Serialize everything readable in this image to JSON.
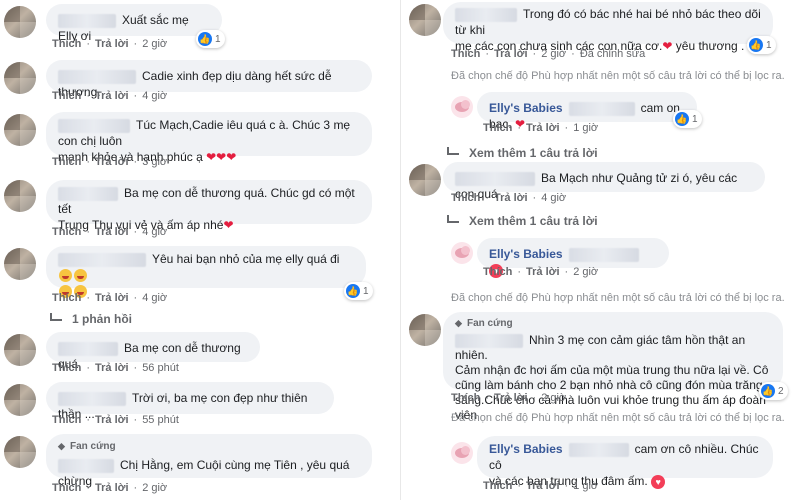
{
  "actions": {
    "like": "Thích",
    "reply": "Trả lời",
    "edited": "Đã chỉnh sửa"
  },
  "badge": {
    "fan": "Fan cứng"
  },
  "left": {
    "c1": {
      "text": "Xuất sắc mẹ Elly ơi",
      "time": "2 giờ",
      "react_count": "1"
    },
    "c2": {
      "text": "Cadie xinh đẹp dịu dàng hết sức dễ thương.",
      "time": "4 giờ"
    },
    "c3": {
      "text_1": "Túc Mạch,Cadie iêu quá c à. Chúc 3 mẹ con chị luôn",
      "text_2": "mạnh khỏe và hạnh phúc ạ",
      "time": "3 giờ"
    },
    "c4": {
      "text_1": "Ba mẹ con dễ thương quá. Chúc gd có một tết",
      "text_2": "Trung Thu vui vẻ và ấm áp nhé",
      "time": "4 giờ"
    },
    "c5": {
      "text_1": "Yêu hai bạn nhỏ của mẹ elly quá đi",
      "time": "4 giờ",
      "react_count": "1",
      "replies": "1 phản hồi"
    },
    "c6": {
      "text": "Ba mẹ con dễ thương quá",
      "time": "56 phút"
    },
    "c7": {
      "text": "Trời ơi, ba mẹ con đẹp như thiên thần ...",
      "time": "55 phút"
    },
    "c8": {
      "text": "Chị Hằng, em Cuội cùng mẹ Tiên , yêu quá chừng",
      "time": "2 giờ"
    }
  },
  "right": {
    "c1": {
      "text_1": "Trong đó có bác nhé hai bé nhỏ bác theo dõi từ khi",
      "text_2": "mẹ các con chưa sinh các con nữa cơ.",
      "text_3": "yêu thương .",
      "time": "2 giờ",
      "react_count": "1"
    },
    "filter_note": "Đã chọn chế độ Phù hợp nhất nên một số câu trả lời có thể bị lọc ra.",
    "r1": {
      "name": "Elly's Babies",
      "text": "cam on bac.",
      "time": "1 giờ",
      "react_count": "1"
    },
    "more_replies": "Xem thêm 1 câu trả lời",
    "c2": {
      "text": "Ba Mạch như Quảng tử zi ó, yêu các con quá",
      "time": "4 giờ"
    },
    "r2": {
      "name": "Elly's Babies",
      "time": "2 giờ"
    },
    "c3": {
      "text_1": "Nhìn 3 mẹ con cảm giác tâm hồn thật an nhiên.",
      "text_2": "Cảm nhận đc hơi ấm của một mùa trung thu nữa lại về. Cô",
      "text_3": "cũng làm bánh cho 2 bạn nhỏ nhà cô cũng đón mùa trăng",
      "text_4": "sáng.Chúc cho cả nhà luôn vui khỏe trung thu ấm áp đoàn viên",
      "time": "2 giờ",
      "react_count": "2"
    },
    "r3": {
      "name": "Elly's Babies",
      "text_1": "cam ơn cô nhiều. Chúc cô",
      "text_2": "và các bạn trung thu đâm ấm.",
      "time": "1 giờ"
    }
  },
  "colors": {
    "bubble": "#f0f2f5",
    "link": "#385898",
    "meta": "#65676b",
    "like": "#1877f2",
    "heart": "#e41e3f"
  }
}
